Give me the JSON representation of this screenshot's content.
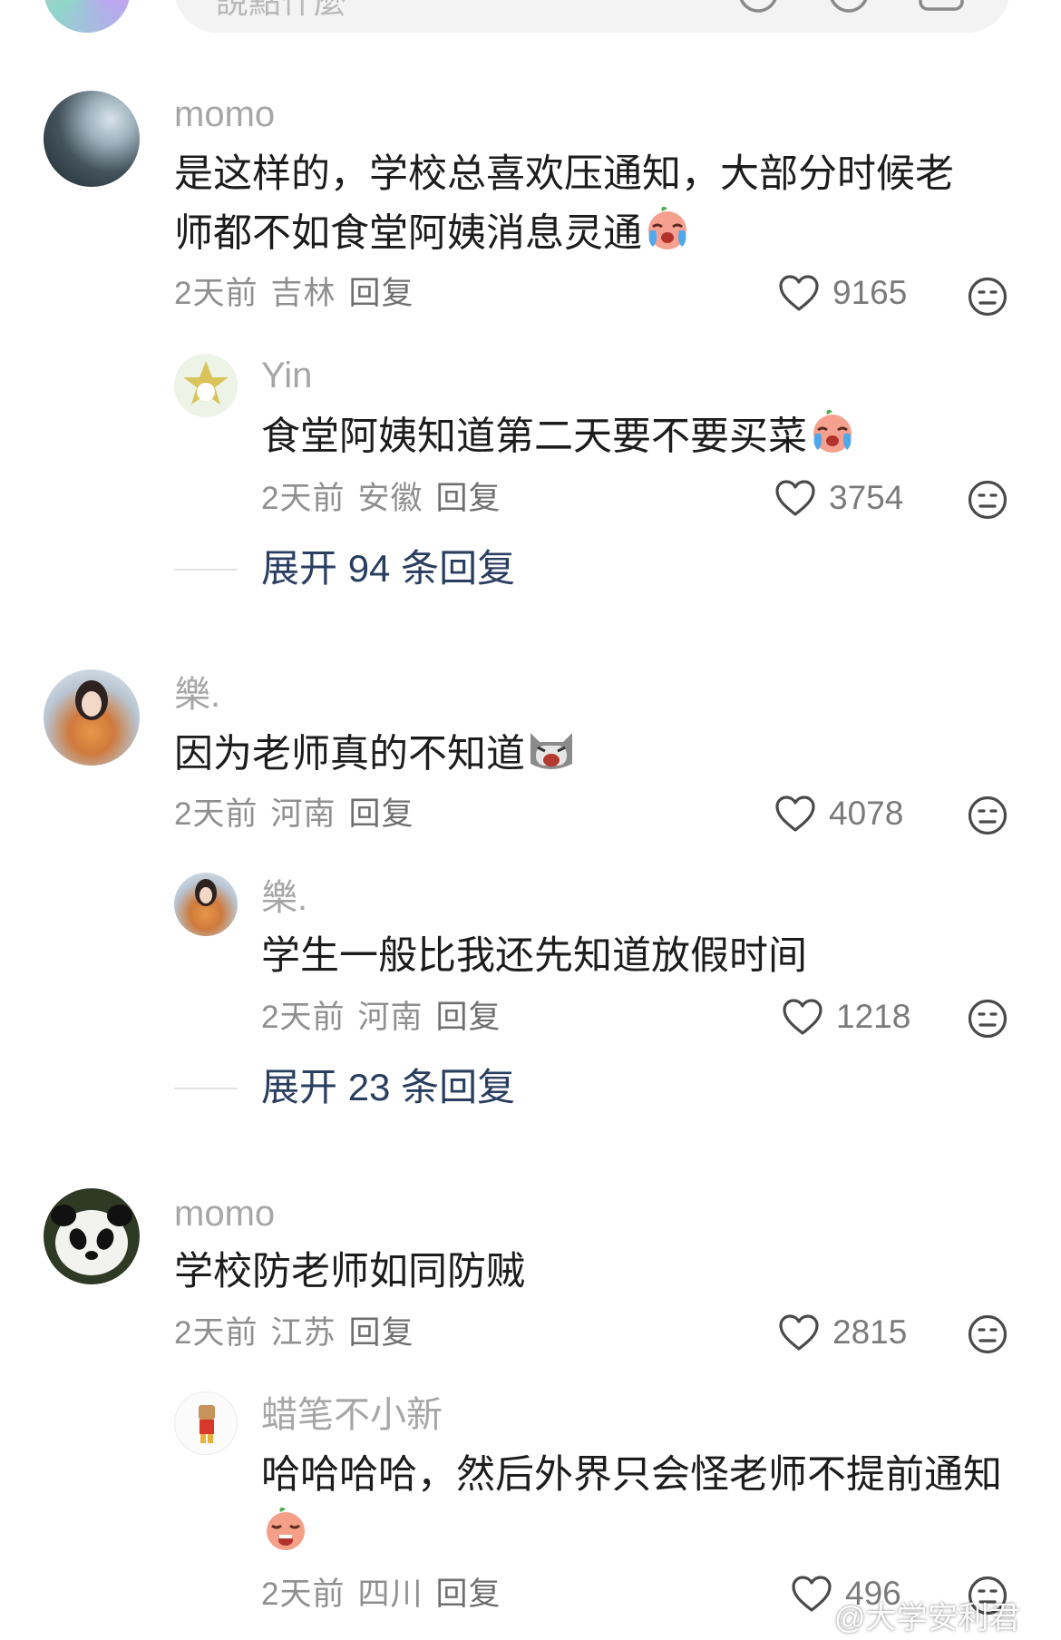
{
  "search": {
    "placeholder": "說點什麼"
  },
  "comments": [
    {
      "username": "momo",
      "text": "是这样的，学校总喜欢压通知，大部分时候老师都不如食堂阿姨消息灵通",
      "time": "2天前",
      "location": "吉林",
      "reply_label": "回复",
      "likes": "9165",
      "reply": {
        "username": "Yin",
        "text": "食堂阿姨知道第二天要不要买菜",
        "time": "2天前",
        "location": "安徽",
        "reply_label": "回复",
        "likes": "3754"
      },
      "expand": {
        "prefix": "展开",
        "count": "94",
        "suffix": "条回复"
      }
    },
    {
      "username": "樂.",
      "text": "因为老师真的不知道",
      "time": "2天前",
      "location": "河南",
      "reply_label": "回复",
      "likes": "4078",
      "reply": {
        "username": "樂.",
        "text": "学生一般比我还先知道放假时间",
        "time": "2天前",
        "location": "河南",
        "reply_label": "回复",
        "likes": "1218"
      },
      "expand": {
        "prefix": "展开",
        "count": "23",
        "suffix": "条回复"
      }
    },
    {
      "username": "momo",
      "text": "学校防老师如同防贼",
      "time": "2天前",
      "location": "江苏",
      "reply_label": "回复",
      "likes": "2815",
      "reply": {
        "username": "蜡笔不小新",
        "text": "哈哈哈哈，然后外界只会怪老师不提前通知",
        "time": "2天前",
        "location": "四川",
        "reply_label": "回复",
        "likes": "496"
      }
    }
  ],
  "watermark": "@大学安利君",
  "colors": {
    "expand": "#2a3e60",
    "username": "#a6a6a6",
    "meta": "#8f8f8f"
  }
}
